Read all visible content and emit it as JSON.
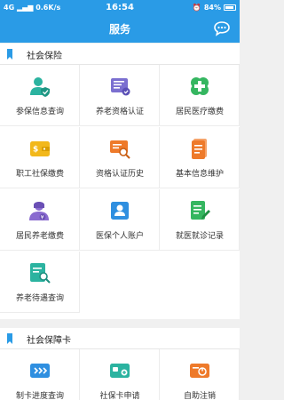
{
  "status_bar": {
    "network": "4G",
    "speed": "0.6K/s",
    "time": "16:54",
    "battery": "84%"
  },
  "header": {
    "title": "服务"
  },
  "sections": [
    {
      "title": "社会保险",
      "items": [
        {
          "label": "参保信息查询",
          "icon": "person-shield-icon",
          "color": "#2bb3a0"
        },
        {
          "label": "养老资格认证",
          "icon": "document-stamp-icon",
          "color": "#7b6fd0"
        },
        {
          "label": "居民医疗缴费",
          "icon": "medical-cross-icon",
          "color": "#35b660"
        },
        {
          "label": "职工社保缴费",
          "icon": "wallet-icon",
          "color": "#f2b81b"
        },
        {
          "label": "资格认证历史",
          "icon": "history-search-icon",
          "color": "#ee7a2a"
        },
        {
          "label": "基本信息维护",
          "icon": "info-document-icon",
          "color": "#ee7a2a"
        },
        {
          "label": "居民养老缴费",
          "icon": "elder-payment-icon",
          "color": "#8a6bd0"
        },
        {
          "label": "医保个人账户",
          "icon": "id-card-icon",
          "color": "#2f8fe0"
        },
        {
          "label": "就医就诊记录",
          "icon": "edit-record-icon",
          "color": "#35b660"
        },
        {
          "label": "养老待遇查询",
          "icon": "pension-search-icon",
          "color": "#2bb3a0"
        }
      ]
    },
    {
      "title": "社会保障卡",
      "items": [
        {
          "label": "制卡进度查询",
          "icon": "card-progress-icon",
          "color": "#2f8fe0"
        },
        {
          "label": "社保卡申请",
          "icon": "card-apply-icon",
          "color": "#2bb3a0"
        },
        {
          "label": "自助注销",
          "icon": "card-cancel-icon",
          "color": "#ee7a2a"
        }
      ]
    }
  ]
}
